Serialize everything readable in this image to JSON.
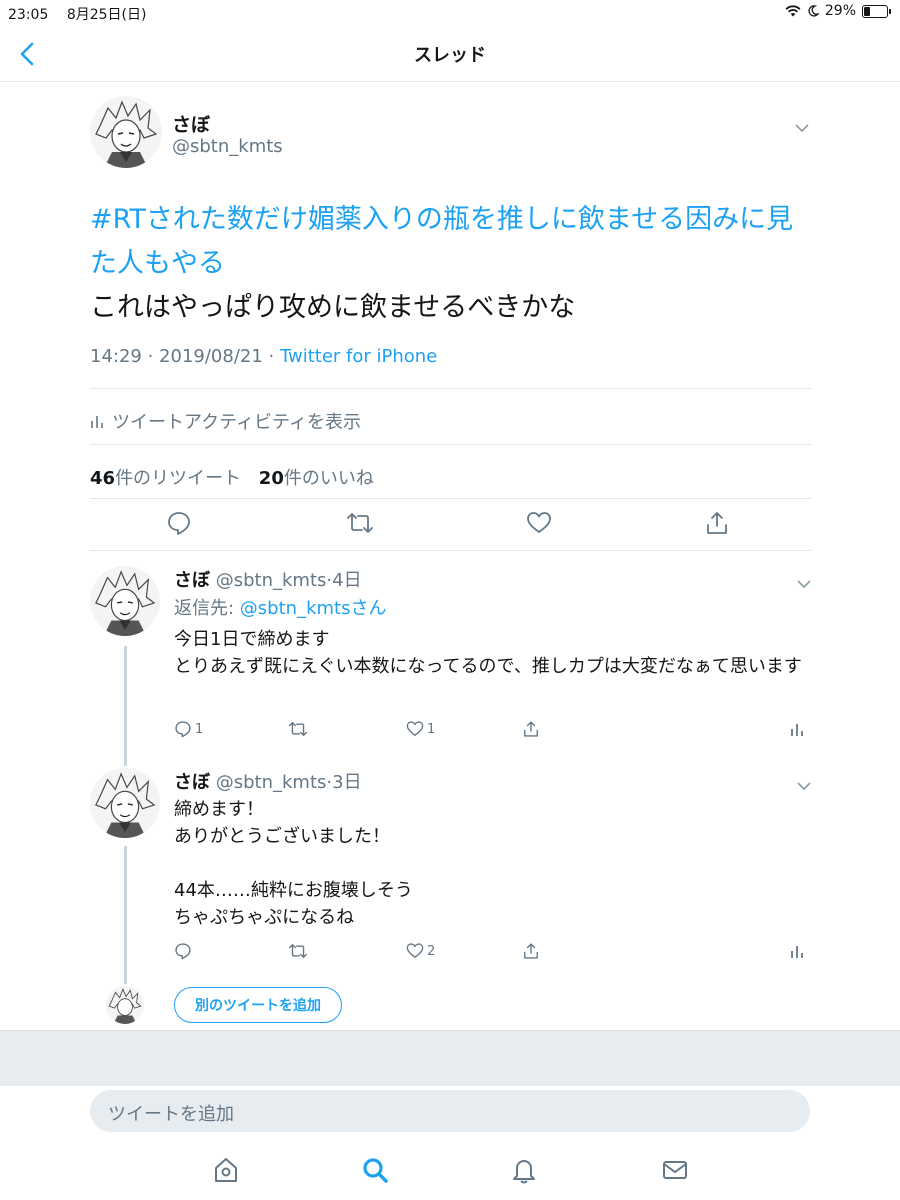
{
  "status_bar": {
    "time": "23:05",
    "date": "8月25日(日)",
    "battery": "29%",
    "battery_level": 0.29
  },
  "nav": {
    "title": "スレッド"
  },
  "main_tweet": {
    "name": "さぼ",
    "handle": "@sbtn_kmts",
    "hashtag_text": "#RTされた数だけ媚薬入りの瓶を推しに飲ませる因みに見た人もやる",
    "body_text": "これはやっぱり攻めに飲ませるべきかな",
    "time": "14:29",
    "separator": " · ",
    "date": "2019/08/21",
    "source": "Twitter for iPhone",
    "activity_label": "ツイートアクティビティを表示",
    "retweet_count": "46",
    "retweet_label": "件のリツイート",
    "like_count": "20",
    "like_label": "件のいいね"
  },
  "replies": [
    {
      "name": "さぼ",
      "handle": "@sbtn_kmts",
      "age": "·4日",
      "reply_to_prefix": "返信先: ",
      "reply_to_handle": "@sbtn_kmtsさん",
      "text": "今日1日で締めます\nとりあえず既にえぐい本数になってるので、推しカプは大変だなぁて思います",
      "reply_count": "1",
      "retweet_count": "",
      "like_count": "1"
    },
    {
      "name": "さぼ",
      "handle": "@sbtn_kmts",
      "age": "·3日",
      "text": "締めます！\nありがとうございました！\n\n44本……純粋にお腹壊しそう\nちゃぷちゃぷになるね",
      "reply_count": "",
      "retweet_count": "",
      "like_count": "2"
    }
  ],
  "add_tweet_button": "別のツイートを追加",
  "compose": {
    "placeholder": "ツイートを追加"
  },
  "colors": {
    "accent": "#1da1f2",
    "muted": "#657786",
    "divider": "#e1e8ed",
    "band": "#e6ecf0"
  },
  "icons": [
    "back-chevron-icon",
    "reply-icon",
    "retweet-icon",
    "like-icon",
    "share-icon",
    "analytics-icon",
    "caret-down-icon",
    "home-icon",
    "search-icon",
    "notifications-icon",
    "messages-icon"
  ]
}
